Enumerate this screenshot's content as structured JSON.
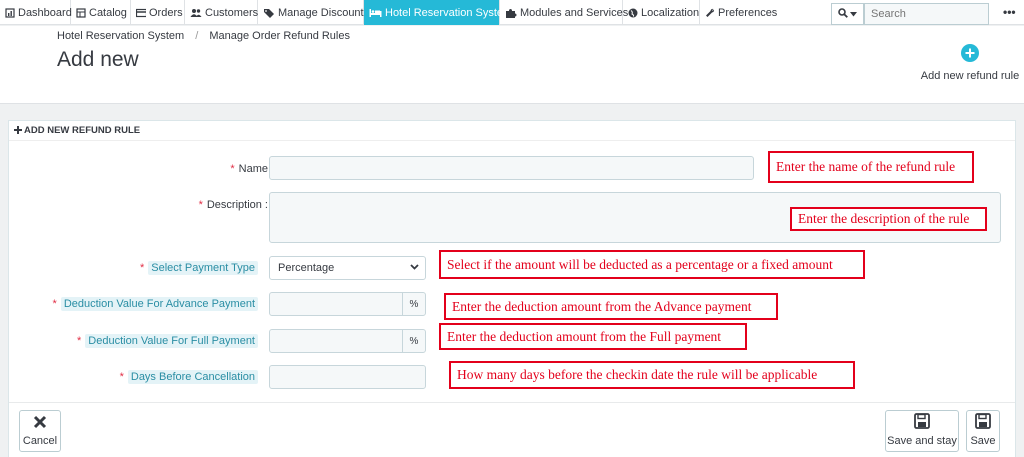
{
  "nav": {
    "items": [
      {
        "label": "Dashboard",
        "icon": "dashboard-icon"
      },
      {
        "label": "Catalog",
        "icon": "catalog-icon"
      },
      {
        "label": "Orders",
        "icon": "orders-icon"
      },
      {
        "label": "Customers",
        "icon": "customers-icon"
      },
      {
        "label": "Manage Discounts",
        "icon": "tag-icon"
      },
      {
        "label": "Hotel Reservation System",
        "icon": "bed-icon"
      },
      {
        "label": "Modules and Services",
        "icon": "puzzle-icon"
      },
      {
        "label": "Localization",
        "icon": "globe-icon"
      },
      {
        "label": "Preferences",
        "icon": "wrench-icon"
      }
    ],
    "active": "Hotel Reservation System",
    "search_placeholder": "Search",
    "more": "•••"
  },
  "header": {
    "breadcrumb": [
      "Hotel Reservation System",
      "Manage Order Refund Rules"
    ],
    "breadcrumb_sep": "/",
    "title": "Add new",
    "add_button_label": "Add new refund rule"
  },
  "panel": {
    "heading": "ADD NEW REFUND RULE",
    "fields": {
      "name_label": "Name",
      "description_label": "Description :",
      "payment_type_label": "Select Payment Type",
      "payment_type_value": "Percentage",
      "advance_label": "Deduction Value For Advance Payment",
      "advance_addon": "%",
      "full_label": "Deduction Value For Full Payment",
      "full_addon": "%",
      "days_label": "Days Before Cancellation",
      "required_mark": "*"
    },
    "notes": {
      "name": "Enter the name of the refund rule",
      "description": "Enter the description of the rule",
      "payment_type": "Select if the amount will be deducted as a percentage or a fixed amount",
      "advance": "Enter the deduction amount from the Advance payment",
      "full": "Enter the deduction amount from the Full payment",
      "days": "How many days before the checkin date the rule will be applicable"
    },
    "buttons": {
      "cancel": "Cancel",
      "save_and_stay": "Save and stay",
      "save": "Save"
    }
  },
  "colors": {
    "accent": "#25b9d7",
    "required": "#e12e45",
    "annotation": "#e3001b"
  }
}
